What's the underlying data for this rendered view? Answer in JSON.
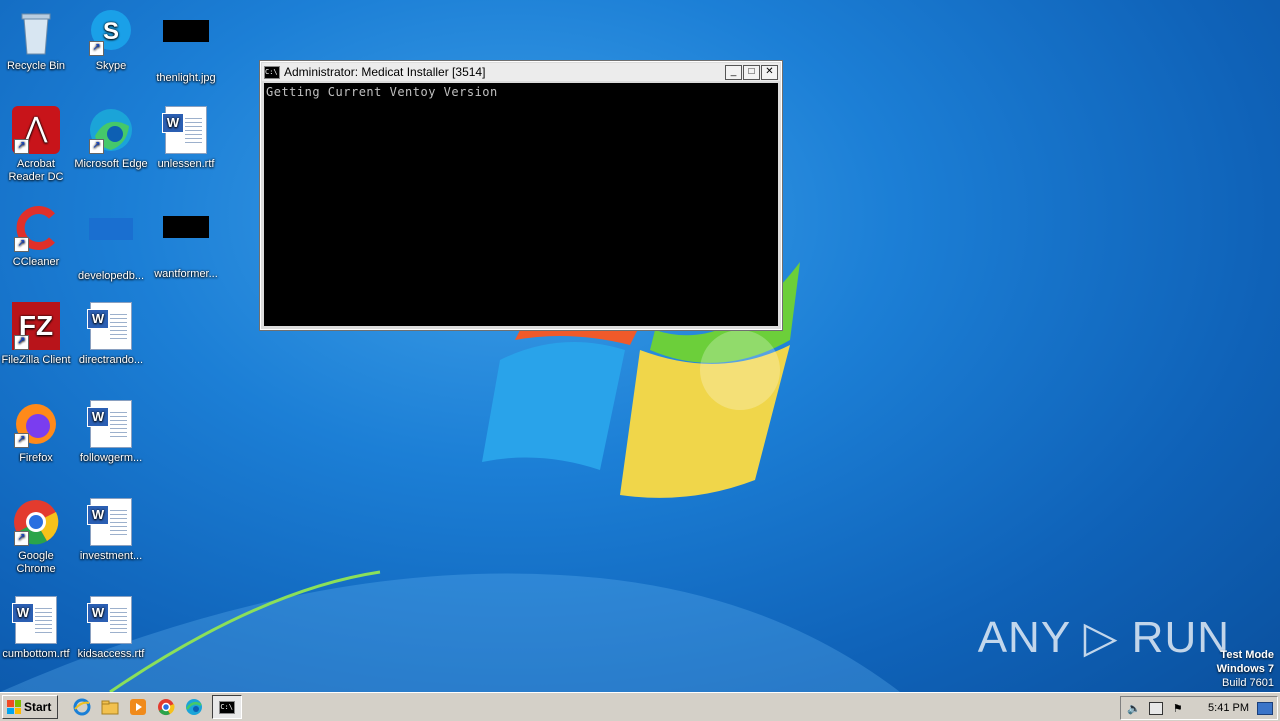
{
  "desktop": {
    "icons": [
      {
        "label": "Recycle Bin"
      },
      {
        "label": "Skype"
      },
      {
        "label": "thenlight.jpg"
      },
      {
        "label": "Acrobat\nReader DC"
      },
      {
        "label": "Microsoft Edge"
      },
      {
        "label": "unlessen.rtf"
      },
      {
        "label": "CCleaner"
      },
      {
        "label": "developedb..."
      },
      {
        "label": "wantformer..."
      },
      {
        "label": "FileZilla Client"
      },
      {
        "label": "directrando..."
      },
      {
        "label": "Firefox"
      },
      {
        "label": "followgerm..."
      },
      {
        "label": "Google\nChrome"
      },
      {
        "label": "investment..."
      },
      {
        "label": "cumbottom.rtf"
      },
      {
        "label": "kidsaccess.rtf"
      }
    ]
  },
  "cmd_window": {
    "title": "Administrator:  Medicat Installer [3514]",
    "output": "Getting Current Ventoy Version",
    "minimize": "_",
    "maximize": "□",
    "close": "✕"
  },
  "taskbar": {
    "start_label": "Start",
    "clock": "5:41 PM"
  },
  "watermark": {
    "brand": "ANY ▷ RUN",
    "line1": "Test Mode",
    "line2": "Windows 7",
    "line3": "Build 7601"
  },
  "colors": {
    "desktop_blue": "#1c7fd6",
    "console_bg": "#000000",
    "console_text": "#c0c0c0",
    "taskbar_bg": "#d4d0c8"
  }
}
